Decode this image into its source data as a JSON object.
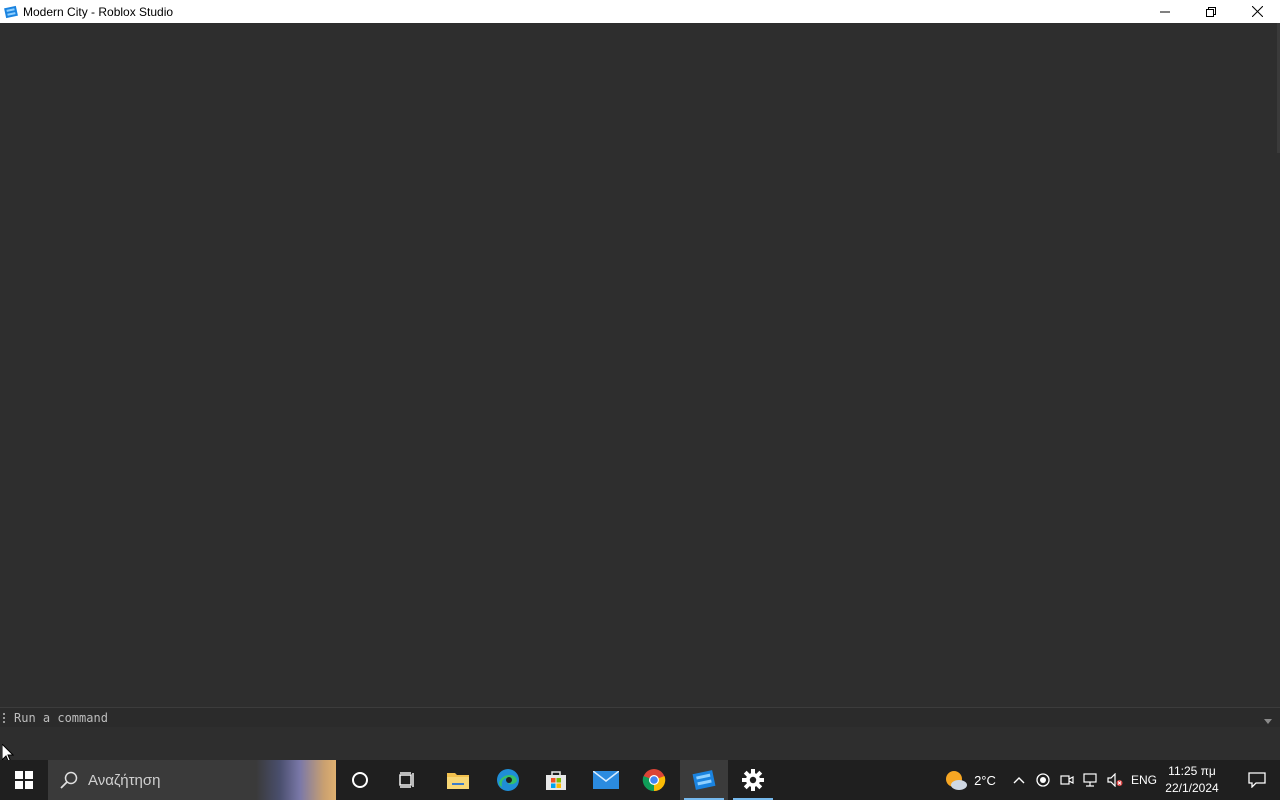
{
  "window": {
    "title": "Modern City - Roblox Studio",
    "controls": {
      "minimize": "minimize",
      "restore": "restore",
      "close": "close"
    }
  },
  "command_bar": {
    "placeholder": "Run a command"
  },
  "taskbar": {
    "search_placeholder": "Αναζήτηση",
    "pinned": [
      "cortana",
      "task-view",
      "file-explorer",
      "edge",
      "microsoft-store",
      "mail",
      "chrome",
      "roblox-studio",
      "settings"
    ],
    "active_app": "roblox-studio",
    "weather": {
      "temp": "2°C"
    },
    "language": "ENG",
    "clock": {
      "time": "11:25 πμ",
      "date": "22/1/2024"
    }
  },
  "colors": {
    "viewport_bg": "#2e2e2e",
    "taskbar_bg": "#1f1f1f",
    "accent": "#76b9ed"
  }
}
